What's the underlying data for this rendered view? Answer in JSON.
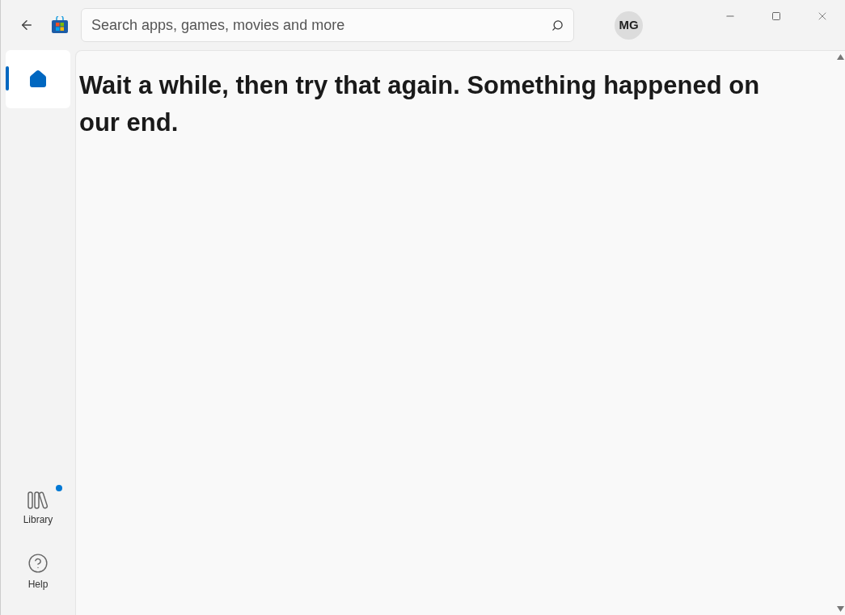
{
  "search": {
    "placeholder": "Search apps, games, movies and more"
  },
  "account": {
    "initials": "MG"
  },
  "nav": [
    {
      "kind": "home",
      "selected": true
    },
    {
      "kind": "library",
      "label": "Library",
      "selected": false,
      "badge": true
    },
    {
      "kind": "help",
      "label": "Help",
      "selected": false,
      "badge": false
    }
  ],
  "message": "Wait a while, then try that again. Something happened on our end."
}
